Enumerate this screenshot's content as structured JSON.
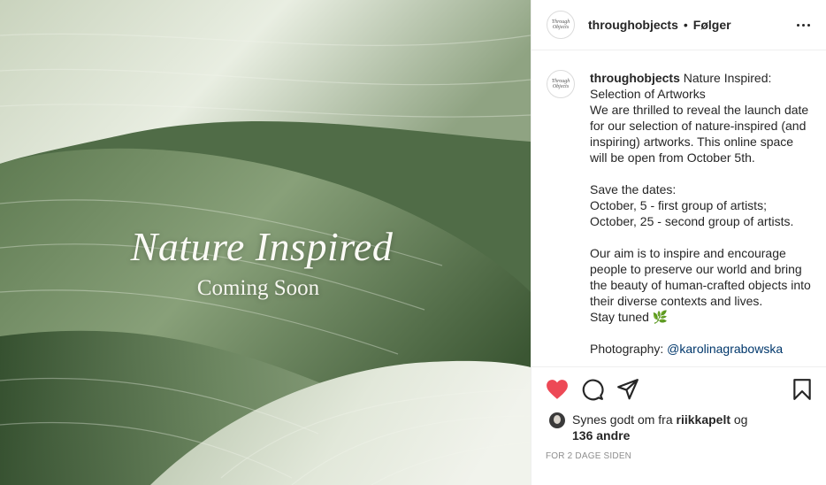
{
  "post": {
    "username": "throughobjects",
    "separator": "•",
    "follow_label": "Følger",
    "avatar_text": "Through Objects",
    "more_icon": "more-horizontal-icon"
  },
  "media": {
    "title": "Nature Inspired",
    "subtitle": "Coming Soon",
    "colors": {
      "leaf_dark": "#3f5a37",
      "leaf_mid": "#6f8a62",
      "leaf_light": "#dfe6d6"
    }
  },
  "caption": {
    "username": "throughobjects",
    "paragraphs": [
      " Nature Inspired: Selection of Artworks",
      "We are thrilled to reveal the launch date for our selection of nature-inspired (and inspiring) artworks. This online space will be open from October 5th.",
      "Save the dates:",
      "October, 5 - first group of artists;",
      "October, 25 - second group of artists.",
      "Our aim is to inspire and encourage people to preserve our world and bring the beauty of human-crafted objects into their diverse contexts and lives.",
      "Stay tuned 🌿",
      "Photography: ",
      "@karolinagrabowska"
    ]
  },
  "actions": {
    "like_icon": "heart-icon",
    "comment_icon": "comment-icon",
    "share_icon": "share-icon",
    "save_icon": "bookmark-icon",
    "like_color": "#ed4956"
  },
  "likes": {
    "prefix": "Synes godt om fra ",
    "user": "riikkapelt",
    "joiner": " og",
    "count": "136 andre"
  },
  "timestamp": "FOR 2 DAGE SIDEN"
}
